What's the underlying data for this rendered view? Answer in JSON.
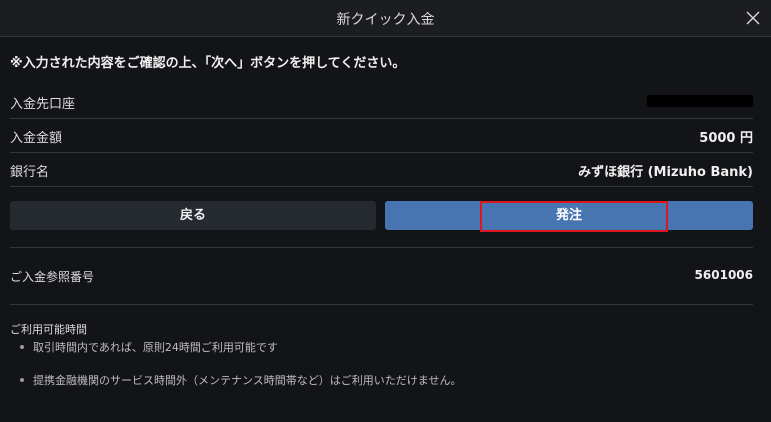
{
  "dialog": {
    "title": "新クイック入金",
    "close_label": "×"
  },
  "notice": "※入力された内容をご確認の上、「次へ」ボタンを押してください。",
  "details": [
    {
      "label": "入金先口座",
      "value": ""
    },
    {
      "label": "入金金額",
      "value": "5000 円"
    },
    {
      "label": "銀行名",
      "value": "みずほ銀行 (Mizuho Bank)"
    }
  ],
  "buttons": {
    "back_label": "戻る",
    "order_label": "発注"
  },
  "reference": {
    "label": "ご入金参照番号",
    "value": "5601006"
  },
  "hours": {
    "title": "ご利用可能時間",
    "items": [
      "取引時間内であれば、原則24時間ご利用可能です",
      "提携金融機関のサービス時間外（メンテナンス時間帯など）はご利用いただけません。"
    ]
  },
  "colors": {
    "background": "#131418",
    "primary_button": "#4775b2",
    "secondary_button": "#252a31",
    "highlight_border": "#e0141e"
  }
}
